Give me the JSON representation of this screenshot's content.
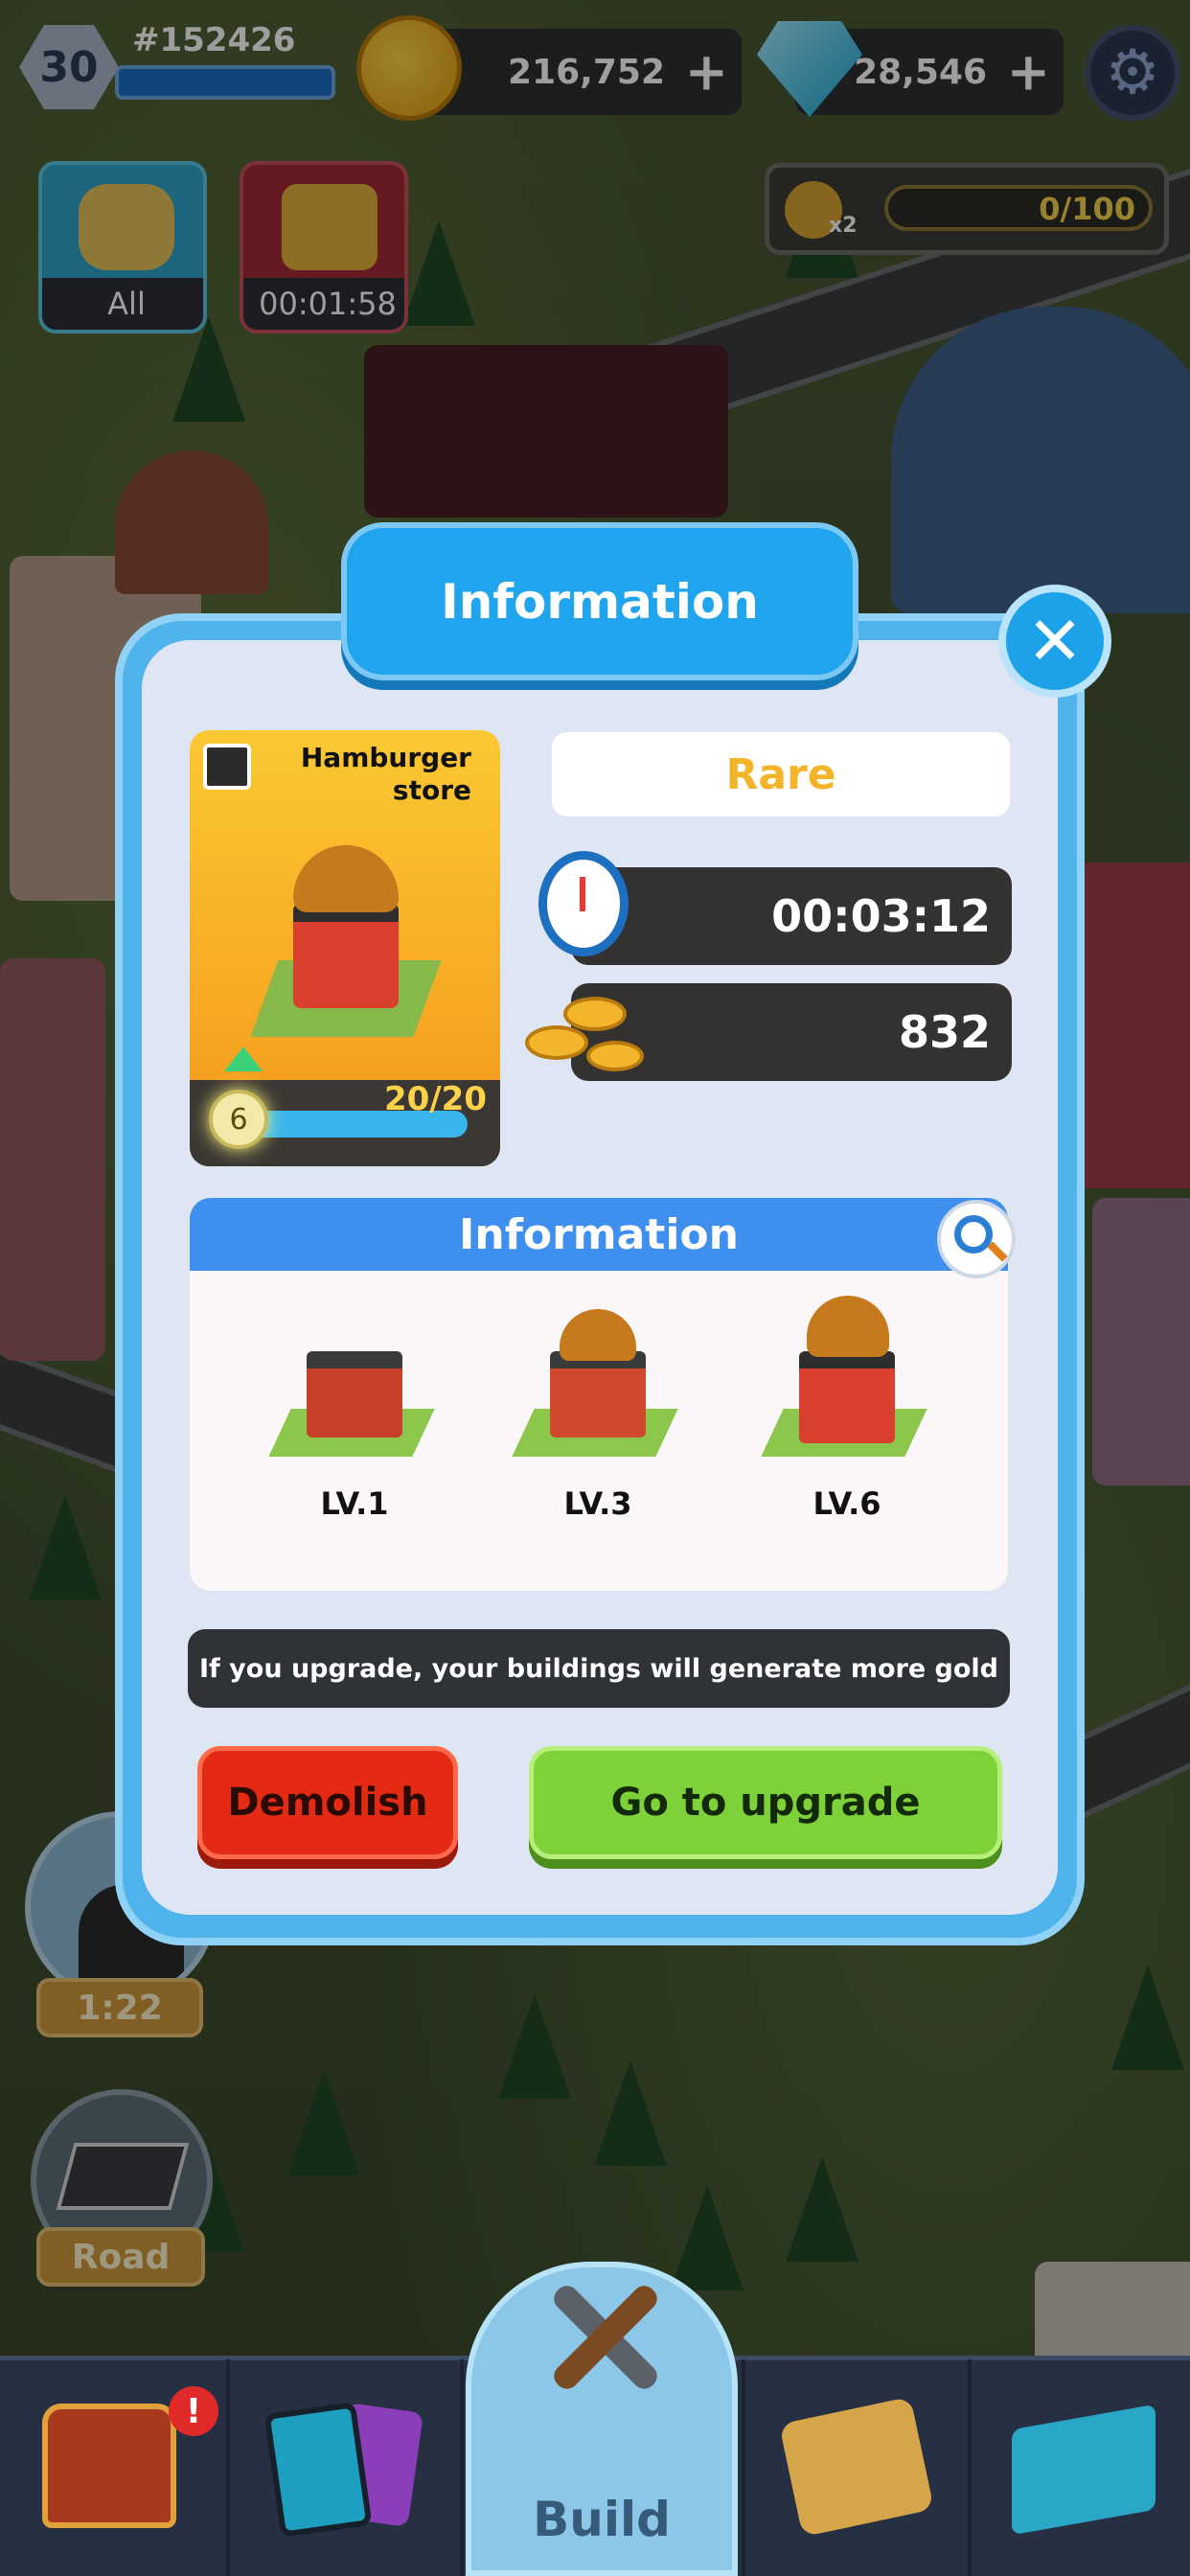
{
  "hud": {
    "player_level": "30",
    "player_id": "#152426",
    "gold": "216,752",
    "gems": "28,546",
    "boost_multiplier": "x2",
    "boost_progress": "0/100"
  },
  "quick_actions": [
    {
      "label": "All"
    },
    {
      "label": "00:01:58"
    }
  ],
  "side_buttons": {
    "advisor_timer": "1:22",
    "road_label": "Road"
  },
  "modal": {
    "title": "Information",
    "close_icon": "close-icon",
    "building": {
      "name": "Hamburger store",
      "level": "6",
      "count": "20/20",
      "rarity": "Rare",
      "build_time": "00:03:12",
      "gold_output": "832"
    },
    "info_section": {
      "header": "Information",
      "levels": [
        {
          "label": "LV.1"
        },
        {
          "label": "LV.3"
        },
        {
          "label": "LV.6"
        }
      ]
    },
    "tip": "If you upgrade, your buildings will generate more gold",
    "demolish_label": "Demolish",
    "upgrade_label": "Go to upgrade"
  },
  "bottom_nav": {
    "build_label": "Build",
    "alert_badge": "!"
  },
  "colors": {
    "modal_blue": "#21a4ee",
    "rarity_gold": "#f4b42a",
    "demolish_red": "#e42a12",
    "upgrade_green": "#7fd13a"
  }
}
